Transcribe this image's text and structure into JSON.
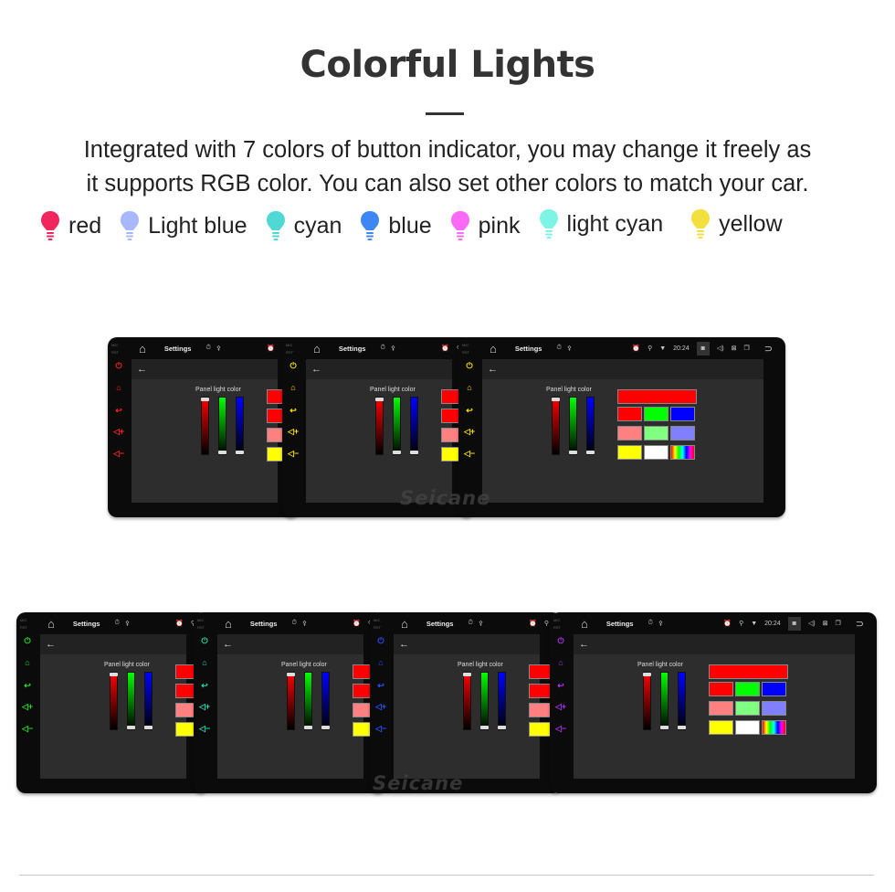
{
  "header": {
    "title": "Colorful Lights",
    "description_line1": "Integrated with 7 colors of button indicator, you may change it freely as",
    "description_line2": "it supports RGB color. You can also set other colors to match your car."
  },
  "legend": [
    {
      "label": "red",
      "icon": "lightbulb-icon",
      "color": "#f2265f"
    },
    {
      "label": "Light blue",
      "icon": "lightbulb-icon",
      "color": "#a8b8ff"
    },
    {
      "label": "cyan",
      "icon": "lightbulb-icon",
      "color": "#4fd8d4"
    },
    {
      "label": "blue",
      "icon": "lightbulb-icon",
      "color": "#3f86f5"
    },
    {
      "label": "pink",
      "icon": "lightbulb-icon",
      "color": "#f86af5"
    },
    {
      "label": "light cyan",
      "icon": "lightbulb-icon",
      "color": "#7ef5e4"
    },
    {
      "label": "yellow",
      "icon": "lightbulb-icon",
      "color": "#f3e03e"
    }
  ],
  "screen": {
    "status_title": "Settings",
    "time": "20:24",
    "panel_label": "Panel light color",
    "mic_label": "MIC",
    "rst_label": "RST",
    "back_icon": "arrow-left-icon",
    "swatches": [
      "#ff0000",
      "#00ff00",
      "#0000ff",
      "#ff8080",
      "#80ff80",
      "#8080ff",
      "#ffff00",
      "#ffffff",
      "rainbow"
    ],
    "top_swatch": "#ff0000",
    "slider_colors": [
      "#ff0000",
      "#00ff00",
      "#0000ff"
    ]
  },
  "screens_button_colors": [
    "#ff2020",
    "#f5e000",
    "#f5e000",
    "#22e022",
    "#1fd8b0",
    "#2a50ff",
    "#b030f0"
  ],
  "watermark": "Seicane"
}
